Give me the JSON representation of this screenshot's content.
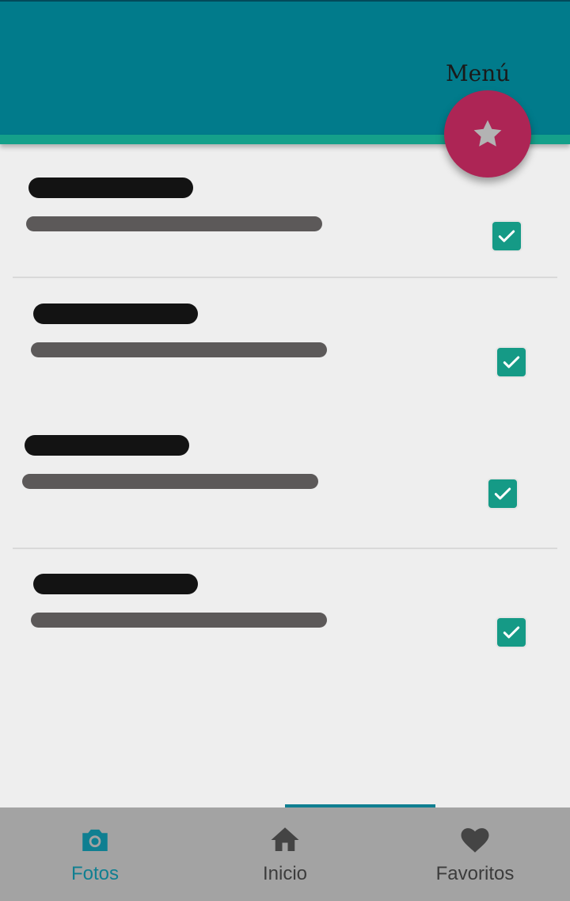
{
  "header": {
    "menu_label": "Menú",
    "fab_icon": "star-icon",
    "colors": {
      "appbar": "#017b8b",
      "stripe": "#14a08a",
      "fab": "#ad2555"
    }
  },
  "list": {
    "items": [
      {
        "title": "",
        "subtitle": "",
        "checked": true
      },
      {
        "title": "",
        "subtitle": "",
        "checked": true
      },
      {
        "title": "",
        "subtitle": "",
        "checked": true
      },
      {
        "title": "",
        "subtitle": "",
        "checked": true
      }
    ],
    "check_color": "#159a86"
  },
  "bottom_nav": {
    "items": [
      {
        "label": "Fotos",
        "icon": "camera-icon",
        "active": true
      },
      {
        "label": "Inicio",
        "icon": "home-icon",
        "active": false
      },
      {
        "label": "Favoritos",
        "icon": "heart-icon",
        "active": false
      }
    ],
    "active_color": "#0f7f91"
  }
}
